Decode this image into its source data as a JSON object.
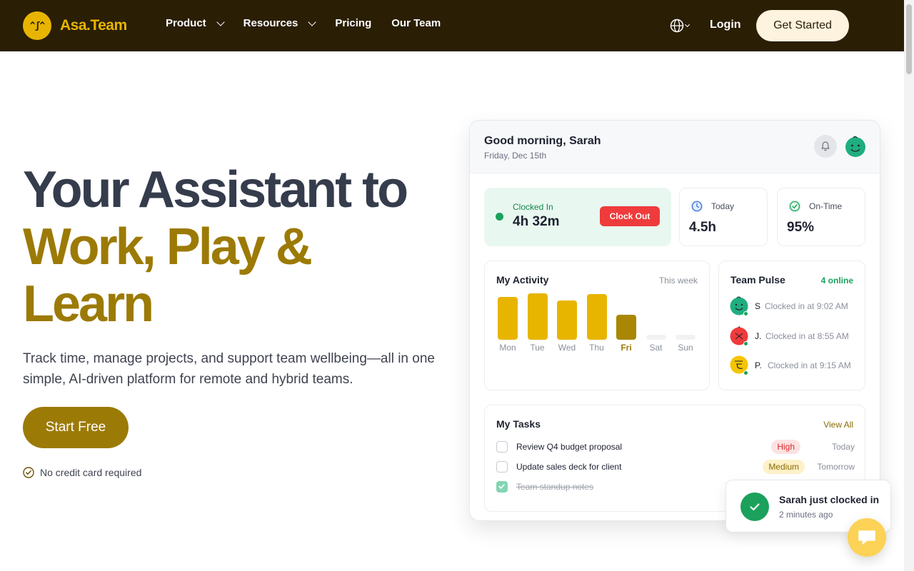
{
  "nav": {
    "logo_text": "Asa.Team",
    "logo_face": "^ʃ^",
    "links": [
      {
        "label": "Product",
        "has_dropdown": true
      },
      {
        "label": "Resources",
        "has_dropdown": true
      },
      {
        "label": "Pricing",
        "has_dropdown": false
      },
      {
        "label": "Our Team",
        "has_dropdown": false
      }
    ],
    "login": "Login",
    "cta": "Get Started"
  },
  "hero": {
    "title_line1": "Your Assistant to",
    "title_line2": "Work, Play &",
    "title_line3": "Learn",
    "subtitle": "Track time, manage projects, and support team wellbeing—all in one simple, AI-driven platform for remote and hybrid teams.",
    "cta": "Start Free",
    "note": "No credit card required"
  },
  "dashboard": {
    "greeting": "Good morning, Sarah",
    "date": "Friday, Dec 15th",
    "clocked_label": "Clocked In",
    "clocked_value": "4h 32m",
    "clock_out": "Clock Out",
    "today_label": "Today",
    "today_value": "4.5h",
    "ontime_label": "On-Time",
    "ontime_value": "95%",
    "activity": {
      "title": "My Activity",
      "period": "This week",
      "days": [
        {
          "day": "Mon",
          "hours": 0.85,
          "today": false
        },
        {
          "day": "Tue",
          "hours": 0.93,
          "today": false
        },
        {
          "day": "Wed",
          "hours": 0.78,
          "today": false
        },
        {
          "day": "Thu",
          "hours": 0.92,
          "today": false
        },
        {
          "day": "Fri",
          "hours": 0.5,
          "today": true
        },
        {
          "day": "Sat",
          "hours": 0,
          "today": false
        },
        {
          "day": "Sun",
          "hours": 0,
          "today": false
        }
      ]
    },
    "pulse": {
      "title": "Team Pulse",
      "online": "4 online",
      "members": [
        {
          "initial": "S",
          "time": "Clocked in at 9:02 AM",
          "color": "#1fae7f"
        },
        {
          "initial": "J.",
          "time": "Clocked in at 8:55 AM",
          "color": "#ef3b3b"
        },
        {
          "initial": "P.",
          "time": "Clocked in at 9:15 AM",
          "color": "#f5c400"
        }
      ]
    },
    "tasks": {
      "title": "My Tasks",
      "view_all": "View All",
      "items": [
        {
          "text": "Review Q4 budget proposal",
          "priority": "High",
          "due": "Today",
          "done": false
        },
        {
          "text": "Update sales deck for client",
          "priority": "Medium",
          "due": "Tomorrow",
          "done": false
        },
        {
          "text": "Team standup notes",
          "priority": "",
          "due": "",
          "done": true
        }
      ]
    }
  },
  "toast": {
    "title": "Sarah just clocked in",
    "time": "2 minutes ago"
  },
  "colors": {
    "nav_bg": "#2a1e05",
    "brand_gold": "#e7b500",
    "accent_gold": "#9c7a06",
    "success": "#1ba15c",
    "danger": "#ef3b3b"
  }
}
